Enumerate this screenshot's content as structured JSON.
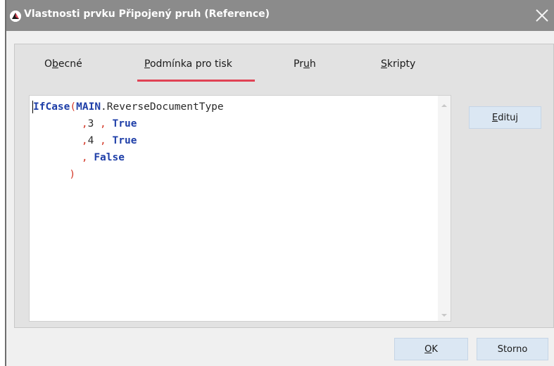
{
  "window": {
    "title": "Vlastnosti prvku Připojený pruh (Reference)",
    "icon": "app-logo-icon",
    "close_icon": "close-icon"
  },
  "tabs": [
    {
      "label": "Obecné",
      "active": false,
      "mnemonic_index": 1
    },
    {
      "label": "Podmínka pro tisk",
      "active": true,
      "mnemonic_index": 0
    },
    {
      "label": "Pruh",
      "active": false,
      "mnemonic_index": 2
    },
    {
      "label": "Skripty",
      "active": false,
      "mnemonic_index": 0
    }
  ],
  "editor": {
    "lines": [
      [
        {
          "t": "IfCase",
          "c": "kw"
        },
        {
          "t": "(",
          "c": "red"
        },
        {
          "t": "MAIN",
          "c": "kw"
        },
        {
          "t": ".ReverseDocumentType",
          "c": "plain"
        }
      ],
      [
        {
          "t": "        ",
          "c": "plain"
        },
        {
          "t": ",",
          "c": "red"
        },
        {
          "t": "3 ",
          "c": "plain"
        },
        {
          "t": ", ",
          "c": "red"
        },
        {
          "t": "True",
          "c": "kw"
        }
      ],
      [
        {
          "t": "        ",
          "c": "plain"
        },
        {
          "t": ",",
          "c": "red"
        },
        {
          "t": "4 ",
          "c": "plain"
        },
        {
          "t": ", ",
          "c": "red"
        },
        {
          "t": "True",
          "c": "kw"
        }
      ],
      [
        {
          "t": "        ",
          "c": "plain"
        },
        {
          "t": ", ",
          "c": "red"
        },
        {
          "t": "False",
          "c": "kw"
        }
      ],
      [
        {
          "t": "      ",
          "c": "plain"
        },
        {
          "t": ")",
          "c": "red"
        }
      ]
    ]
  },
  "buttons": {
    "edit": "Edituj",
    "ok": "OK",
    "cancel": "Storno"
  },
  "colors": {
    "titlebar": "#8b8b8b",
    "tab_accent": "#e04255",
    "keyword": "#1f3fa8",
    "operator": "#d43a2a",
    "button_bg": "#dbe7f3"
  }
}
